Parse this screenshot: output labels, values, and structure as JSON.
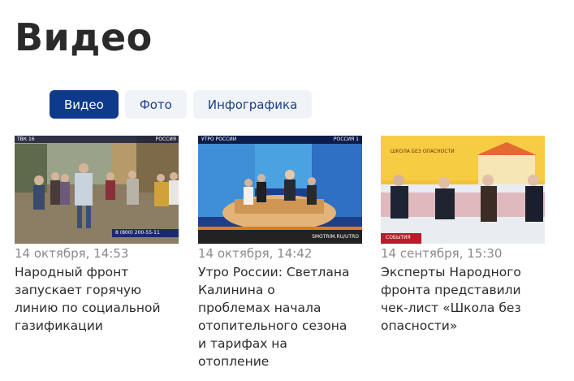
{
  "page": {
    "title": "Видео"
  },
  "tabs": [
    {
      "label": "Видео",
      "active": true
    },
    {
      "label": "Фото",
      "active": false
    },
    {
      "label": "Инфографика",
      "active": false
    }
  ],
  "colors": {
    "accent": "#0e3a8c",
    "tab_inactive_bg": "#f0f3f8",
    "tab_inactive_text": "#1c3f86",
    "date": "#8b8b8b"
  },
  "videos": [
    {
      "date": "14 октября, 14:53",
      "title_lines": [
        "Народный фронт",
        "запускает горячую",
        "линию по социальной",
        "газификации"
      ],
      "overlay_top_left": "ТВК 16",
      "overlay_channel": "РОССИЯ",
      "overlay_phone": "8 (800) 200-55-11"
    },
    {
      "date": "14 октября, 14:42",
      "title_lines": [
        "Утро России: Светлана",
        "Калинина о",
        "проблемах начала",
        "отопительного сезона",
        "и тарифах на",
        "отопление"
      ],
      "overlay_top_left": "УТРО РОССИИ",
      "overlay_channel": "РОССИЯ 1",
      "overlay_bottom": "SMOTRIM.RU/UTRO"
    },
    {
      "date": "14 сентября, 15:30",
      "title_lines": [
        "Эксперты Народного",
        "фронта представили",
        "чек-лист «Школа без",
        "опасности»"
      ],
      "overlay_top_left": "ШКОЛА БЕЗ ОПАСНОСТИ",
      "overlay_bottom": "СОБЫТИЯ"
    }
  ]
}
